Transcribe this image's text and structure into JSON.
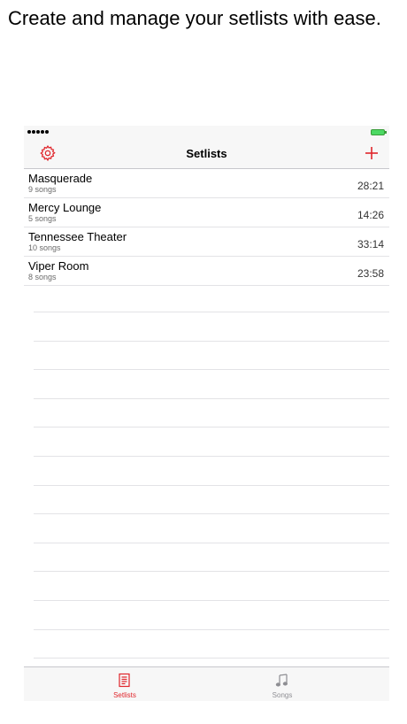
{
  "headline": "Create and manage your setlists with ease.",
  "colors": {
    "accent": "#e0252b",
    "battery": "#4cd964",
    "inactive": "#8e8e93"
  },
  "navbar": {
    "title": "Setlists",
    "left_icon": "gear-icon",
    "right_icon": "plus-icon"
  },
  "setlists": [
    {
      "name": "Masquerade",
      "count": "9 songs",
      "duration": "28:21"
    },
    {
      "name": "Mercy Lounge",
      "count": "5 songs",
      "duration": "14:26"
    },
    {
      "name": "Tennessee Theater",
      "count": "10 songs",
      "duration": "33:14"
    },
    {
      "name": "Viper Room",
      "count": "8 songs",
      "duration": "23:58"
    }
  ],
  "tabbar": {
    "tabs": [
      {
        "label": "Setlists",
        "icon": "setlist-document-icon",
        "active": true
      },
      {
        "label": "Songs",
        "icon": "music-note-icon",
        "active": false
      }
    ]
  }
}
